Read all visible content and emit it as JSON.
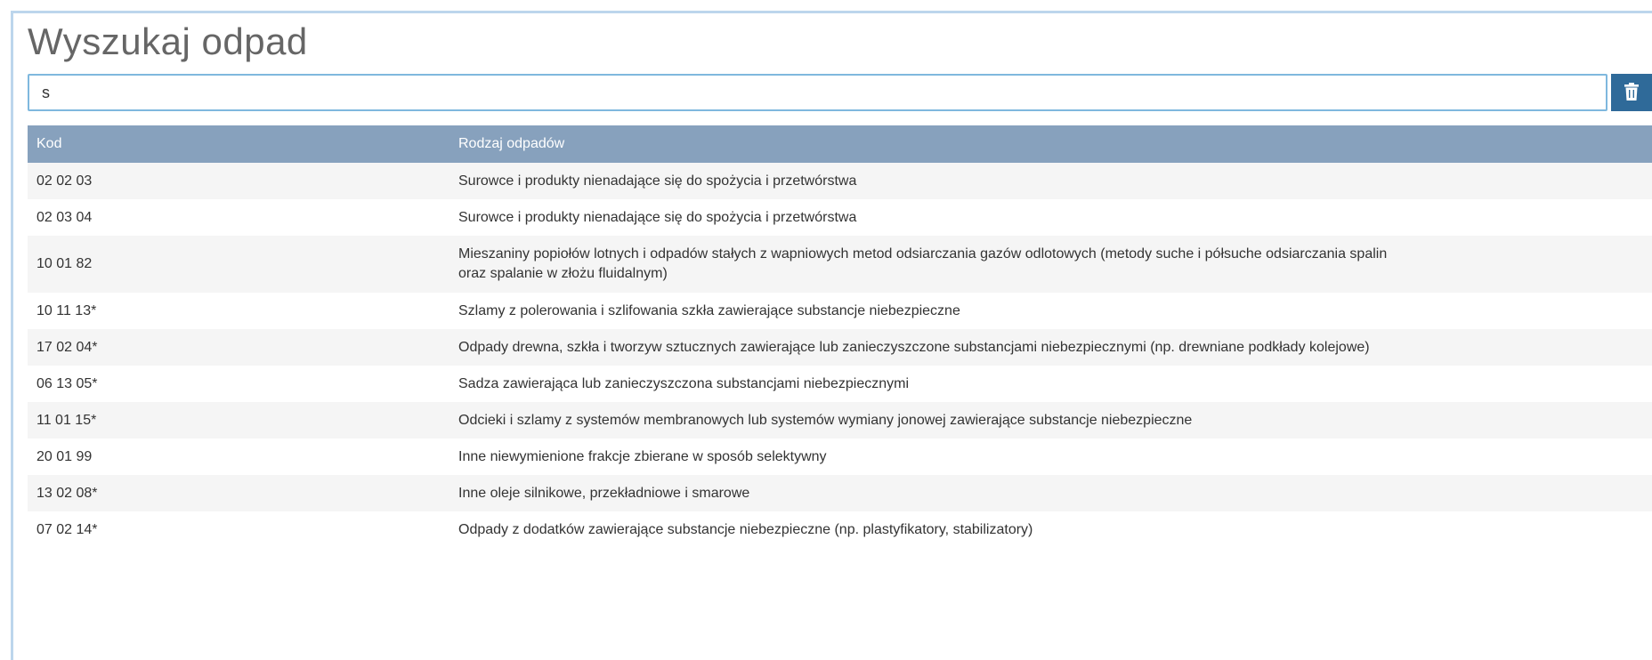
{
  "page": {
    "title": "Wyszukaj odpad"
  },
  "search": {
    "value": "s",
    "placeholder": ""
  },
  "clear_icon": "trash-icon",
  "colors": {
    "header_bg": "#87a1bd",
    "button_bg": "#2f6a99",
    "input_border": "#7fb8de"
  },
  "table": {
    "columns": [
      "Kod",
      "Rodzaj odpadów"
    ],
    "rows": [
      {
        "code": "02 02 03",
        "name": "Surowce i produkty nienadające się do spożycia i przetwórstwa"
      },
      {
        "code": "02 03 04",
        "name": "Surowce i produkty nienadające się do spożycia i przetwórstwa"
      },
      {
        "code": "10 01 82",
        "name": "Mieszaniny popiołów lotnych i odpadów stałych z wapniowych metod odsiarczania gazów odlotowych (metody suche i półsuche odsiarczania spalin oraz spalanie w złożu fluidalnym)"
      },
      {
        "code": "10 11 13*",
        "name": "Szlamy z polerowania i szlifowania szkła zawierające substancje niebezpieczne"
      },
      {
        "code": "17 02 04*",
        "name": "Odpady drewna, szkła i tworzyw sztucznych zawierające lub zanieczyszczone substancjami niebezpiecznymi (np. drewniane podkłady kolejowe)"
      },
      {
        "code": "06 13 05*",
        "name": "Sadza zawierająca lub zanieczyszczona substancjami niebezpiecznymi"
      },
      {
        "code": "11 01 15*",
        "name": "Odcieki i szlamy z systemów membranowych lub systemów wymiany jonowej zawierające substancje niebezpieczne"
      },
      {
        "code": "20 01 99",
        "name": "Inne niewymienione frakcje zbierane w sposób selektywny"
      },
      {
        "code": "13 02 08*",
        "name": "Inne oleje silnikowe, przekładniowe i smarowe"
      },
      {
        "code": "07 02 14*",
        "name": "Odpady z dodatków zawierające substancje niebezpieczne (np. plastyfikatory, stabilizatory)"
      }
    ]
  }
}
